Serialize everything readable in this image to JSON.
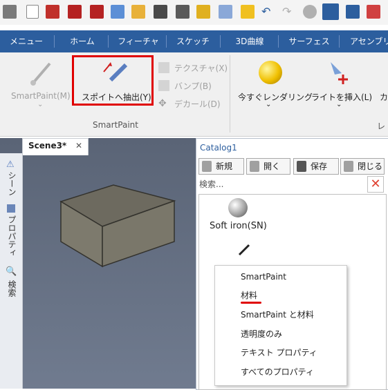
{
  "tabs": [
    "メニュー",
    "ホーム",
    "フィーチャ",
    "スケッチ",
    "3D曲線",
    "サーフェス",
    "アセンブリ"
  ],
  "ribbon": {
    "smartpaint_m": "SmartPaint(M)",
    "spuit_extract": "スポイトへ抽出(Y)",
    "texture": "テクスチャ(X)",
    "bump": "バンプ(B)",
    "decal": "デカール(D)",
    "group_smartpaint": "SmartPaint",
    "render_now": "今すぐレンダリング",
    "insert_light": "ライトを挿入(L)",
    "camera_partial": "カ",
    "render_group_partial": "レ"
  },
  "document_tab": {
    "label": "Scene3*",
    "close": "✕"
  },
  "side_panel": {
    "scene": "シーン",
    "properties": "プロパティ",
    "search": "検索"
  },
  "catalog": {
    "title": "Catalog1",
    "new": "新規",
    "open": "開く",
    "save": "保存",
    "close": "閉じる",
    "search_placeholder": "検索...",
    "item_name": "Soft iron(SN)"
  },
  "context_menu": {
    "items": [
      "SmartPaint",
      "材料",
      "SmartPaint と材料",
      "透明度のみ",
      "テキスト プロパティ",
      "すべてのプロパティ"
    ]
  },
  "colors": {
    "tab_bar": "#2c5e9e",
    "highlight_box": "#e00000",
    "underline": "#e00000",
    "viewport": "#5a6476"
  }
}
